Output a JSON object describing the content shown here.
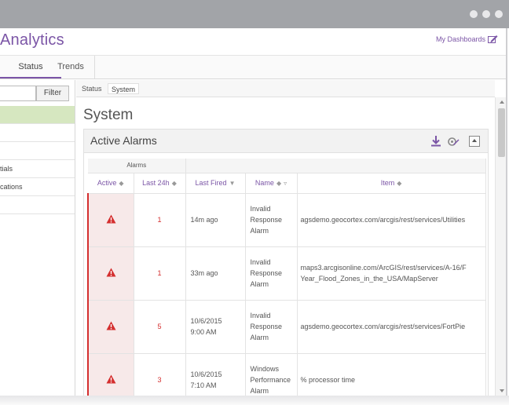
{
  "app": {
    "title": "Analytics"
  },
  "header": {
    "my_dashboards": "My Dashboards"
  },
  "tabs": [
    {
      "label": "Status"
    },
    {
      "label": "Trends"
    }
  ],
  "filter": {
    "button": "Filter",
    "value": ""
  },
  "sidebar": {
    "items": [
      {
        "label": ""
      },
      {
        "label": ""
      },
      {
        "label": ""
      },
      {
        "label": "tials"
      },
      {
        "label": "cations"
      },
      {
        "label": ""
      }
    ]
  },
  "breadcrumb": {
    "root": "Status",
    "current": "System"
  },
  "page": {
    "title": "System"
  },
  "panel": {
    "title": "Active Alarms"
  },
  "table": {
    "group_header": "Alarms",
    "columns": {
      "active": "Active",
      "last24": "Last 24h",
      "last_fired": "Last Fired",
      "name": "Name",
      "item": "Item"
    },
    "rows": [
      {
        "last24": "1",
        "fired_1": "14m ago",
        "fired_2": "",
        "name_1": "Invalid",
        "name_2": "Response",
        "name_3": "Alarm",
        "item_1": "agsdemo.geocortex.com/arcgis/rest/services/Utilities",
        "item_2": ""
      },
      {
        "last24": "1",
        "fired_1": "33m ago",
        "fired_2": "",
        "name_1": "Invalid",
        "name_2": "Response",
        "name_3": "Alarm",
        "item_1": "maps3.arcgisonline.com/ArcGIS/rest/services/A-16/F",
        "item_2": "Year_Flood_Zones_in_the_USA/MapServer"
      },
      {
        "last24": "5",
        "fired_1": "10/6/2015",
        "fired_2": "9:00 AM",
        "name_1": "Invalid",
        "name_2": "Response",
        "name_3": "Alarm",
        "item_1": "agsdemo.geocortex.com/arcgis/rest/services/FortPie",
        "item_2": ""
      },
      {
        "last24": "3",
        "fired_1": "10/6/2015",
        "fired_2": "7:10 AM",
        "name_1": "Windows",
        "name_2": "Performance",
        "name_3": "Alarm",
        "item_1": "% processor time",
        "item_2": ""
      }
    ]
  },
  "icons": {
    "alert": "warning-triangle-icon",
    "download": "download-icon",
    "settings": "edit-gear-icon",
    "collapse": "collapse-icon"
  },
  "colors": {
    "accent": "#7b55a6",
    "alert": "#d42e2e",
    "selected_row": "#d6e7c0",
    "chrome": "#a2a4a8"
  }
}
